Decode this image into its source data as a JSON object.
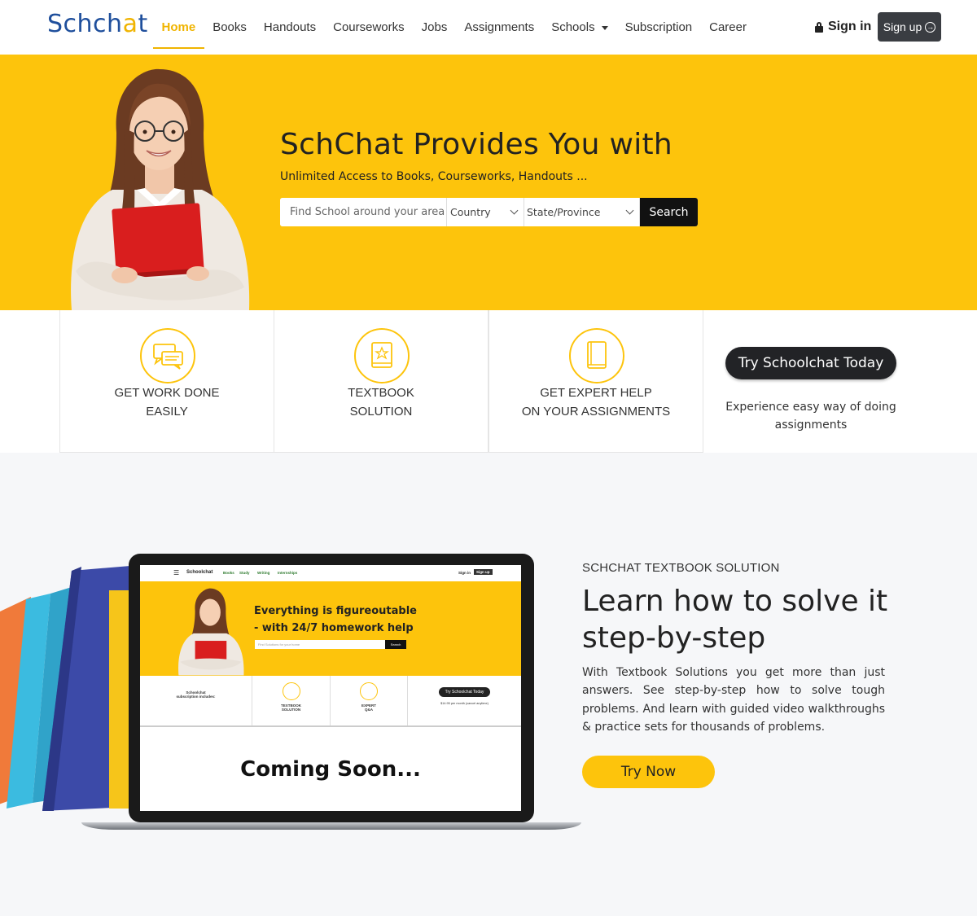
{
  "brand": {
    "logo_prefix": "Schch",
    "logo_accent": "a",
    "logo_suffix": "t"
  },
  "nav": {
    "items": [
      {
        "label": "Home",
        "active": true
      },
      {
        "label": "Books"
      },
      {
        "label": "Handouts"
      },
      {
        "label": "Courseworks"
      },
      {
        "label": "Jobs"
      },
      {
        "label": "Assignments"
      },
      {
        "label": "Schools",
        "dropdown": true
      },
      {
        "label": "Subscription"
      },
      {
        "label": "Career"
      }
    ],
    "signin_label": "Sign in",
    "signup_label": "Sign up"
  },
  "hero": {
    "title": "SchChat Provides You with",
    "subtitle": "Unlimited Access to Books, Courseworks, Handouts ...",
    "search_placeholder": "Find School around your area",
    "country_label": "Country",
    "state_label": "State/Province",
    "search_button": "Search"
  },
  "features": [
    {
      "line1": "GET WORK DONE",
      "line2": "EASILY",
      "icon": "chat-bubbles-icon"
    },
    {
      "line1": "TEXTBOOK",
      "line2": "SOLUTION",
      "icon": "textbook-star-icon"
    },
    {
      "line1": "GET EXPERT HELP",
      "line2": "ON YOUR ASSIGNMENTS",
      "icon": "book-icon"
    }
  ],
  "promo": {
    "button": "Try Schoolchat Today",
    "description": "Experience easy way of doing assignments"
  },
  "textbook": {
    "eyebrow": "SCHCHAT TEXTBOOK SOLUTION",
    "heading": "Learn how to solve it step-by-step",
    "body": "With Textbook Solutions you get more than just answers. See step-by-step how to solve tough problems. And learn with guided video walkthroughs & practice sets for thousands of problems.",
    "cta": "Try Now"
  },
  "mockup": {
    "brand": "Schoolchat",
    "nav": [
      "Books",
      "Study",
      "Writing",
      "Internships"
    ],
    "signin": "Sign in",
    "signup": "Sign up",
    "title_line1": "Everything is figureoutable",
    "title_line2": "- with 24/7 homework help",
    "search_placeholder": "Find Solutions for your home",
    "search_button": "Search",
    "feature1_line1": "Schoolchat",
    "feature1_line2": "subscription includes:",
    "feature2_line1": "TEXTBOOK",
    "feature2_line2": "SOLUTION",
    "feature3_line1": "EXPERT",
    "feature3_line2": "Q&A",
    "try_button": "Try Schoolchat Today",
    "price": "$14.95 per month (cancel anytime)",
    "coming_soon": "Coming Soon..."
  },
  "colors": {
    "accent": "#fdc40c",
    "brand_blue": "#1f4f9c",
    "dark": "#222326"
  }
}
